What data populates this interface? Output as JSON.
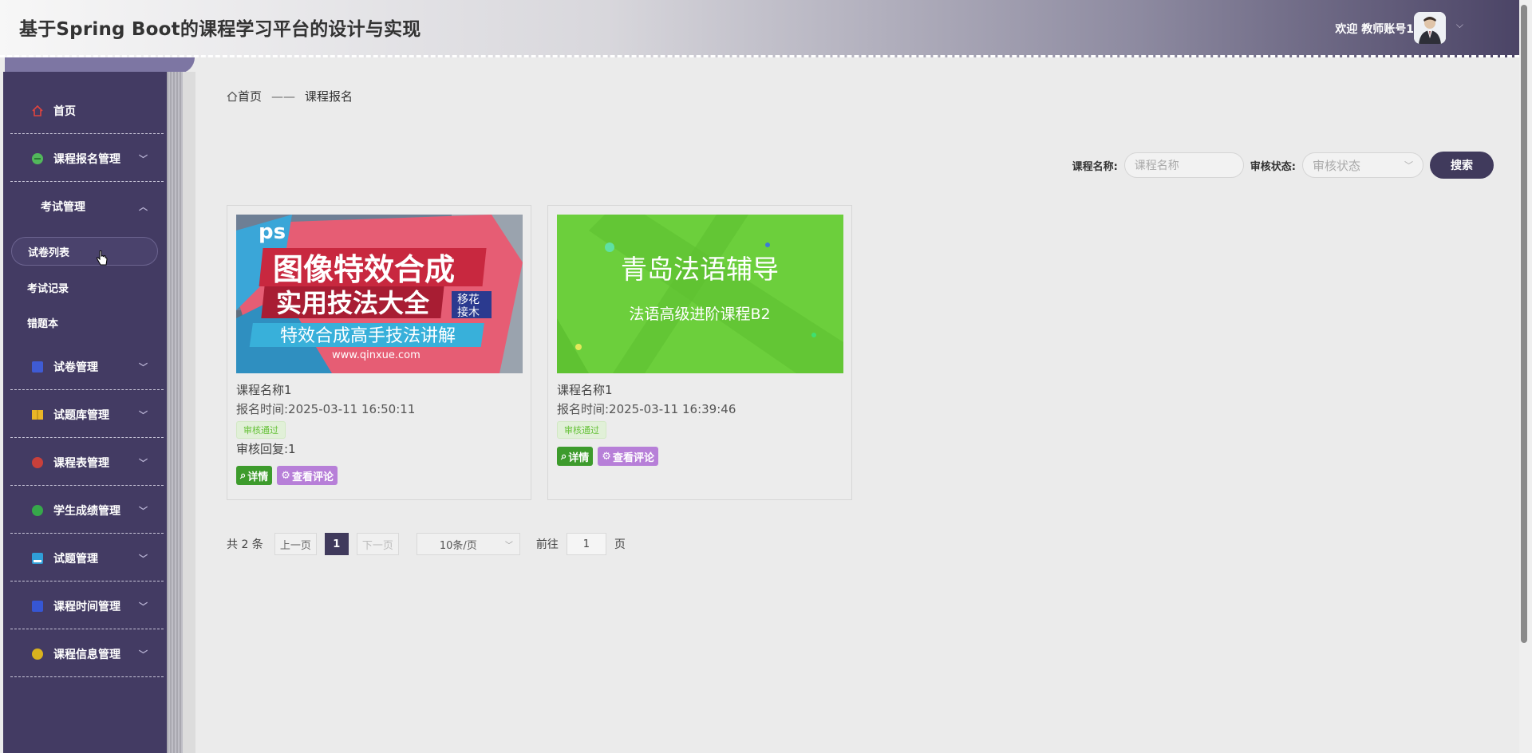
{
  "header": {
    "title": "基于Spring Boot的课程学习平台的设计与实现",
    "welcome": "欢迎 教师账号1"
  },
  "sidebar": {
    "items": [
      {
        "label": "首页",
        "icon": "home-icon",
        "color": "#e0443e"
      },
      {
        "label": "课程报名管理",
        "icon": "circle-icon",
        "color": "#52b85b"
      },
      {
        "label": "考试管理",
        "icon": "none",
        "color": ""
      },
      {
        "label": "试卷管理",
        "icon": "square-icon",
        "color": "#3f5bd4"
      },
      {
        "label": "试题库管理",
        "icon": "square-icon",
        "color": "#e9b627"
      },
      {
        "label": "课程表管理",
        "icon": "circle-icon",
        "color": "#c9403b"
      },
      {
        "label": "学生成绩管理",
        "icon": "circle-icon",
        "color": "#36a84a"
      },
      {
        "label": "试题管理",
        "icon": "square-icon",
        "color": "#2f9ed8"
      },
      {
        "label": "课程时间管理",
        "icon": "square-icon",
        "color": "#3656d4"
      },
      {
        "label": "课程信息管理",
        "icon": "circle-icon",
        "color": "#d9b21e"
      }
    ],
    "sub_items": [
      {
        "label": "试卷列表"
      },
      {
        "label": "考试记录"
      },
      {
        "label": "错题本"
      }
    ]
  },
  "breadcrumb": {
    "home": "首页",
    "sep": "——",
    "current": "课程报名"
  },
  "search": {
    "course_label": "课程名称:",
    "course_placeholder": "课程名称",
    "status_label": "审核状态:",
    "status_placeholder": "审核状态",
    "button": "搜索"
  },
  "cards": [
    {
      "name": "课程名称1",
      "time": "报名时间:2025-03-11 16:50:11",
      "badge": "审核通过",
      "reply": "审核回复:1",
      "detail": "详情",
      "review": "查看评论",
      "image": {
        "ps": "ps",
        "line1": "图像特效合成",
        "line2": "实用技法大全",
        "tag1": "移花",
        "tag2": "接木",
        "line3": "特效合成高手技法讲解",
        "url": "www.qinxue.com"
      }
    },
    {
      "name": "课程名称1",
      "time": "报名时间:2025-03-11 16:39:46",
      "badge": "审核通过",
      "reply": "",
      "detail": "详情",
      "review": "查看评论",
      "image": {
        "line1": "青岛法语辅导",
        "line2": "法语高级进阶课程B2"
      }
    }
  ],
  "pagination": {
    "total": "共 2 条",
    "prev": "上一页",
    "page": "1",
    "next": "下一页",
    "size": "10条/页",
    "goto": "前往",
    "goto_value": "1",
    "page_unit": "页"
  }
}
